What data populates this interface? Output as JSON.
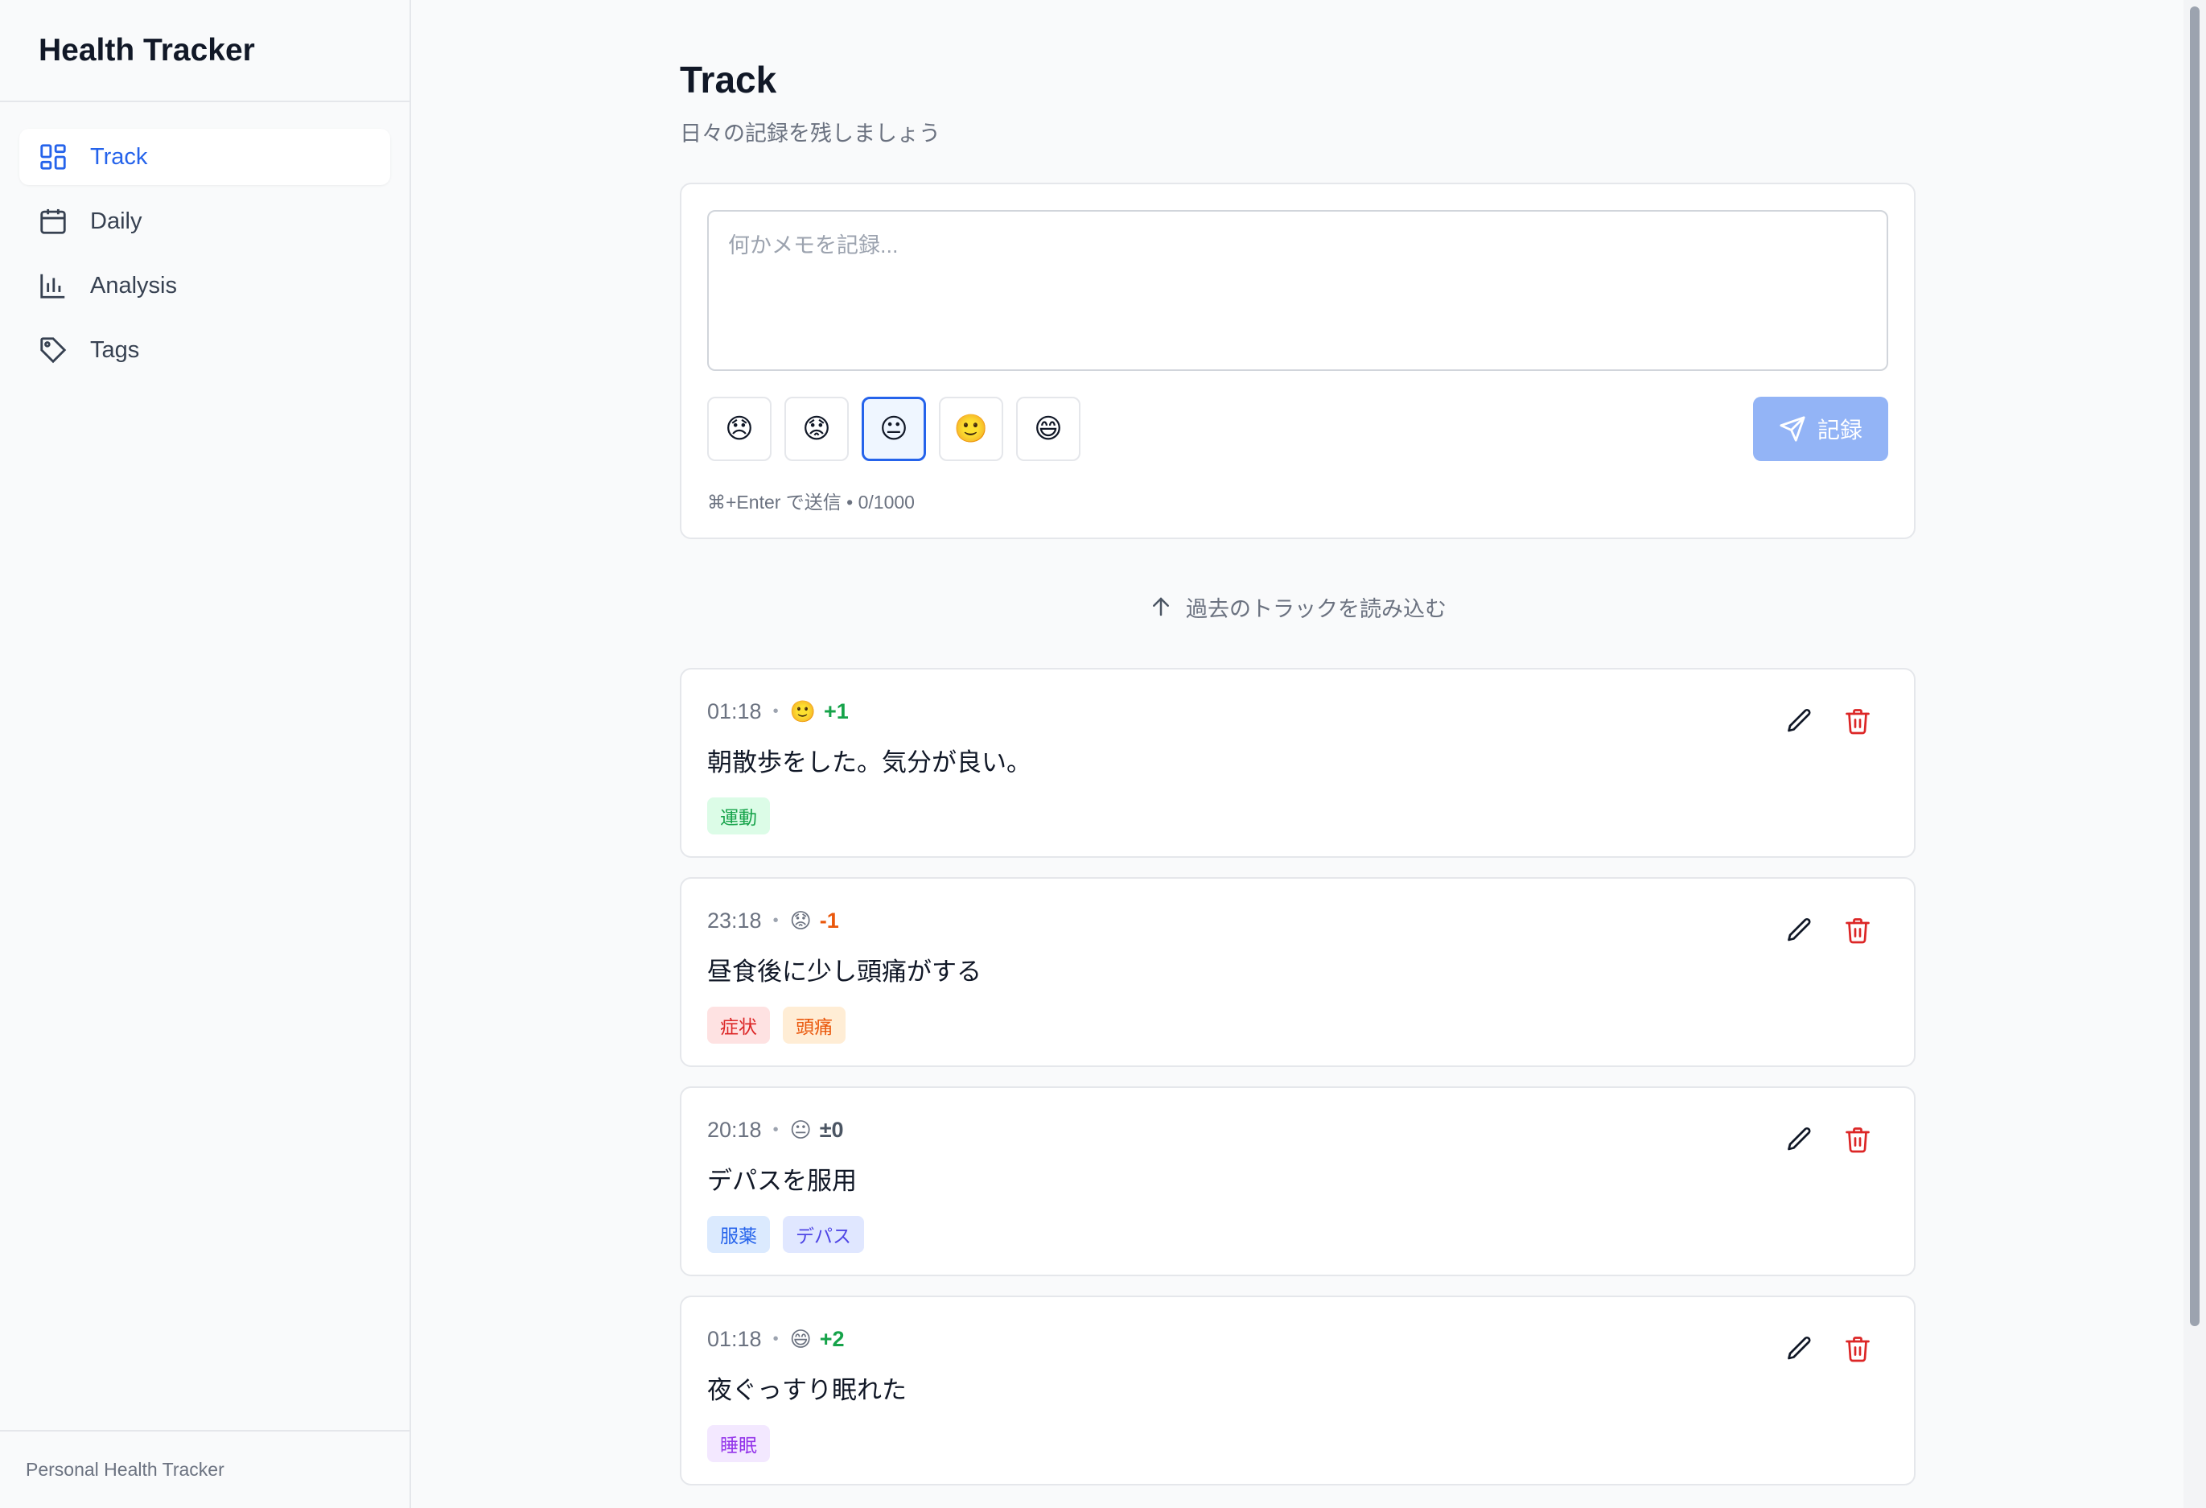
{
  "app": {
    "title": "Health Tracker",
    "footer": "Personal Health Tracker"
  },
  "sidebar": {
    "items": [
      {
        "label": "Track",
        "icon": "dashboard-icon",
        "active": true
      },
      {
        "label": "Daily",
        "icon": "calendar-icon",
        "active": false
      },
      {
        "label": "Analysis",
        "icon": "bar-chart-icon",
        "active": false
      },
      {
        "label": "Tags",
        "icon": "tag-icon",
        "active": false
      }
    ]
  },
  "page": {
    "title": "Track",
    "subtitle": "日々の記録を残しましょう"
  },
  "composer": {
    "placeholder": "何かメモを記録...",
    "moods": [
      "😞",
      "😟",
      "😐",
      "🙂",
      "😄"
    ],
    "selected_mood_index": 2,
    "submit_label": "記録",
    "hint": "⌘+Enter で送信 • 0/1000"
  },
  "load_past": {
    "label": "過去のトラックを読み込む"
  },
  "entries": [
    {
      "time": "01:18",
      "emoji": "🙂",
      "score": "+1",
      "text": "朝散歩をした。気分が良い。",
      "tags": [
        {
          "label": "運動",
          "bg": "#dcfce7",
          "fg": "#16a34a"
        }
      ]
    },
    {
      "time": "23:18",
      "emoji": "😟",
      "score": "-1",
      "text": "昼食後に少し頭痛がする",
      "tags": [
        {
          "label": "症状",
          "bg": "#fee2e2",
          "fg": "#dc2626"
        },
        {
          "label": "頭痛",
          "bg": "#ffedd5",
          "fg": "#ea580c"
        }
      ]
    },
    {
      "time": "20:18",
      "emoji": "😐",
      "score": "±0",
      "text": "デパスを服用",
      "tags": [
        {
          "label": "服薬",
          "bg": "#dbeafe",
          "fg": "#2563eb"
        },
        {
          "label": "デパス",
          "bg": "#e0e7ff",
          "fg": "#4f46e5"
        }
      ]
    },
    {
      "time": "01:18",
      "emoji": "😄",
      "score": "+2",
      "text": "夜ぐっすり眠れた",
      "tags": [
        {
          "label": "睡眠",
          "bg": "#f3e8ff",
          "fg": "#9333ea"
        }
      ]
    }
  ],
  "colors": {
    "accent": "#2563eb",
    "delete": "#dc2626",
    "positive": "#16a34a",
    "negative": "#ea580c"
  }
}
